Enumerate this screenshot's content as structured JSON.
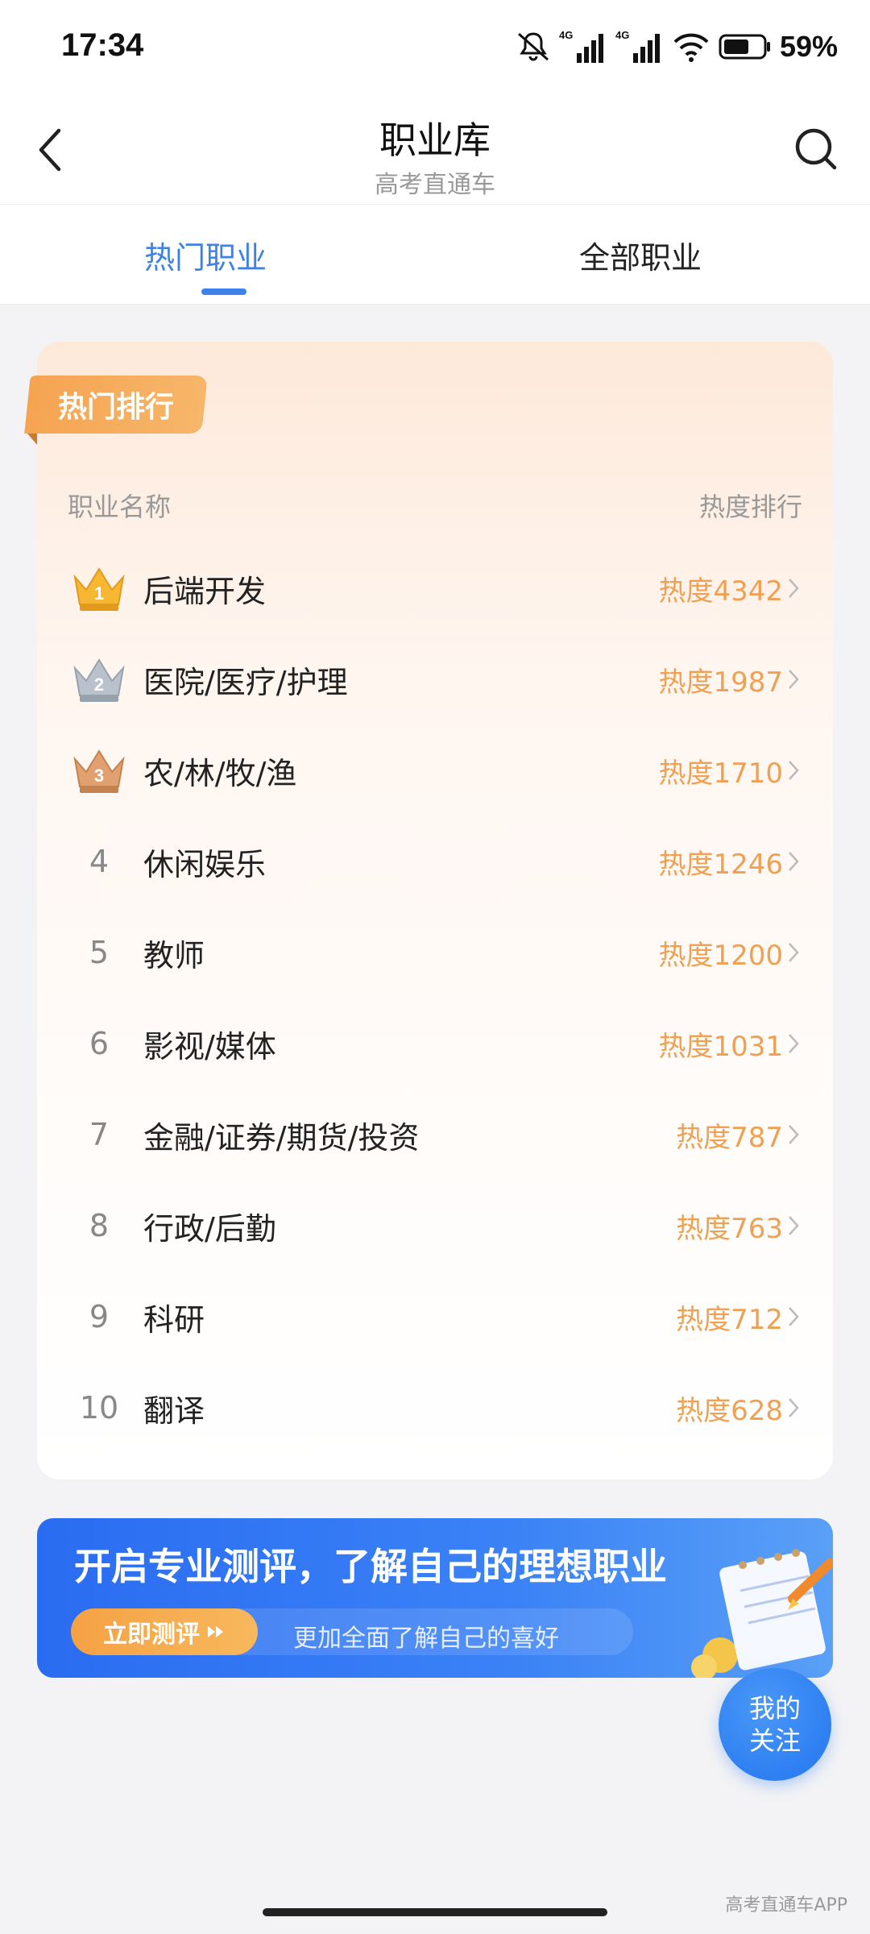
{
  "status_bar": {
    "time": "17:34",
    "battery": "59%",
    "network_1": "4G",
    "network_2": "4G",
    "icons": [
      "mute-icon",
      "signal-icon",
      "signal-icon",
      "wifi-icon",
      "battery-icon"
    ]
  },
  "nav": {
    "title": "职业库",
    "subtitle": "高考直通车",
    "back_icon": "chevron-left-icon",
    "search_icon": "search-icon"
  },
  "tabs": [
    {
      "label": "热门职业",
      "active": true
    },
    {
      "label": "全部职业",
      "active": false
    }
  ],
  "ranking": {
    "badge": "热门排行",
    "header_name": "职业名称",
    "header_rank": "热度排行",
    "items": [
      {
        "rank": "1",
        "name": "后端开发",
        "heat": "热度4342",
        "medal": "gold"
      },
      {
        "rank": "2",
        "name": "医院/医疗/护理",
        "heat": "热度1987",
        "medal": "silver"
      },
      {
        "rank": "3",
        "name": "农/林/牧/渔",
        "heat": "热度1710",
        "medal": "bronze"
      },
      {
        "rank": "4",
        "name": "休闲娱乐",
        "heat": "热度1246"
      },
      {
        "rank": "5",
        "name": "教师",
        "heat": "热度1200"
      },
      {
        "rank": "6",
        "name": "影视/媒体",
        "heat": "热度1031"
      },
      {
        "rank": "7",
        "name": "金融/证券/期货/投资",
        "heat": "热度787"
      },
      {
        "rank": "8",
        "name": "行政/后勤",
        "heat": "热度763"
      },
      {
        "rank": "9",
        "name": "科研",
        "heat": "热度712"
      },
      {
        "rank": "10",
        "name": "翻译",
        "heat": "热度628"
      }
    ]
  },
  "banner": {
    "title": "开启专业测评，了解自己的理想职业",
    "button": "立即测评",
    "subtitle": "更加全面了解自己的喜好"
  },
  "fab": {
    "line1": "我的",
    "line2": "关注"
  },
  "watermark": "高考直通车APP",
  "colors": {
    "accent_blue": "#3c82e8",
    "heat_orange": "#f0a052",
    "badge_orange": "#f5a451"
  }
}
